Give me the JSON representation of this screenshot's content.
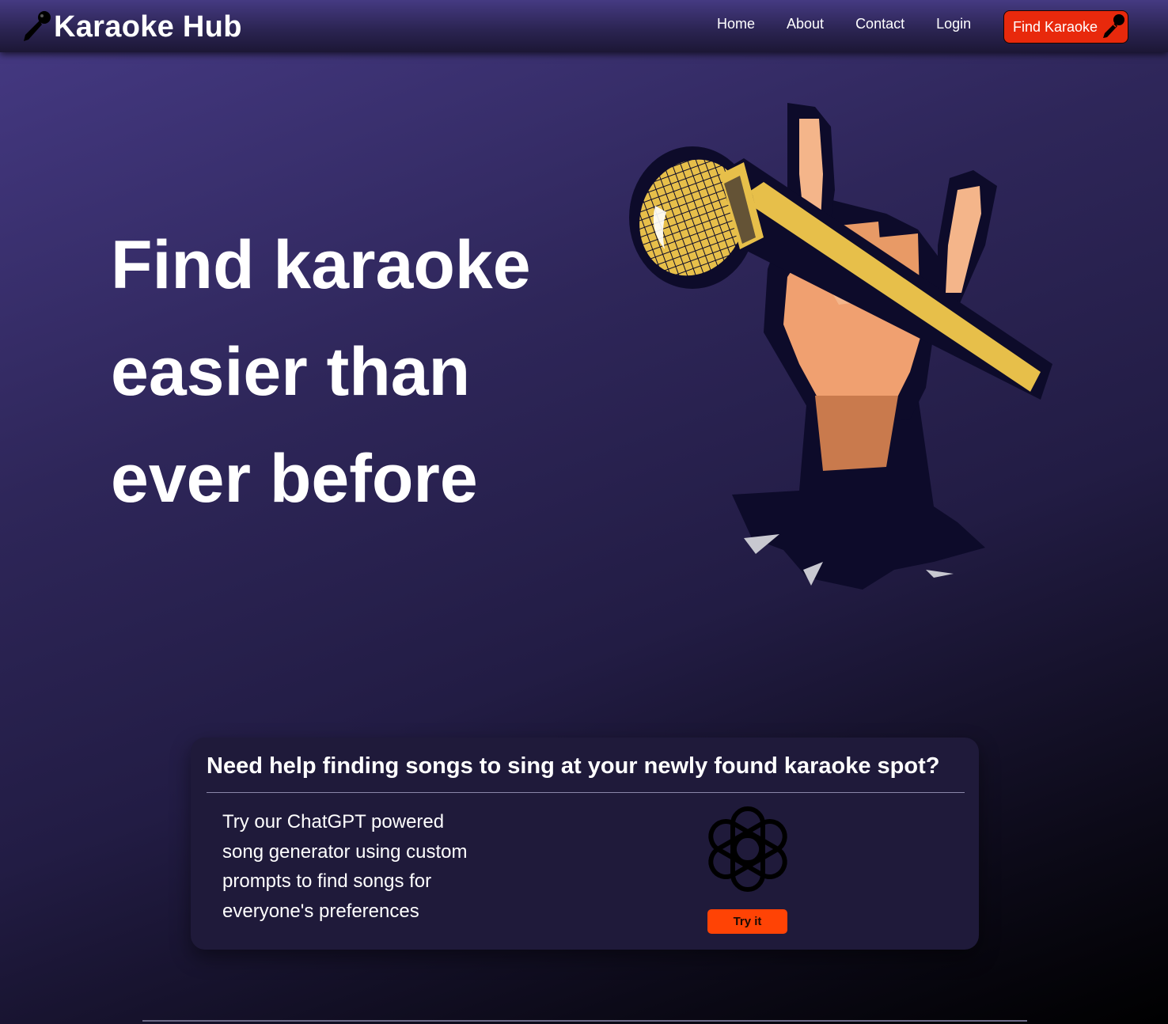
{
  "header": {
    "brand_title": "Karaoke Hub",
    "brand_icon": "microphone-icon",
    "nav": [
      {
        "label": "Home"
      },
      {
        "label": "About"
      },
      {
        "label": "Contact"
      },
      {
        "label": "Login"
      }
    ],
    "cta": {
      "label": "Find Karaoke",
      "icon": "microphone-icon"
    }
  },
  "hero": {
    "title_lines": [
      "Find karaoke",
      "easier than",
      "ever before"
    ],
    "illustration": "hand-holding-microphone-illustration"
  },
  "promo": {
    "heading": "Need help finding songs to sing at your newly found karaoke spot?",
    "text_lines": [
      "Try our ChatGPT powered",
      "song generator using custom",
      "prompts to find songs for",
      "everyone's preferences"
    ],
    "logo_icon": "openai-logo-icon",
    "button_label": "Try it"
  },
  "colors": {
    "accent": "#e8290c",
    "button_orange": "#ff4305",
    "mic_gold": "#e7bf4a",
    "background_top": "#463a85",
    "card_background": "#1f1a3a"
  }
}
